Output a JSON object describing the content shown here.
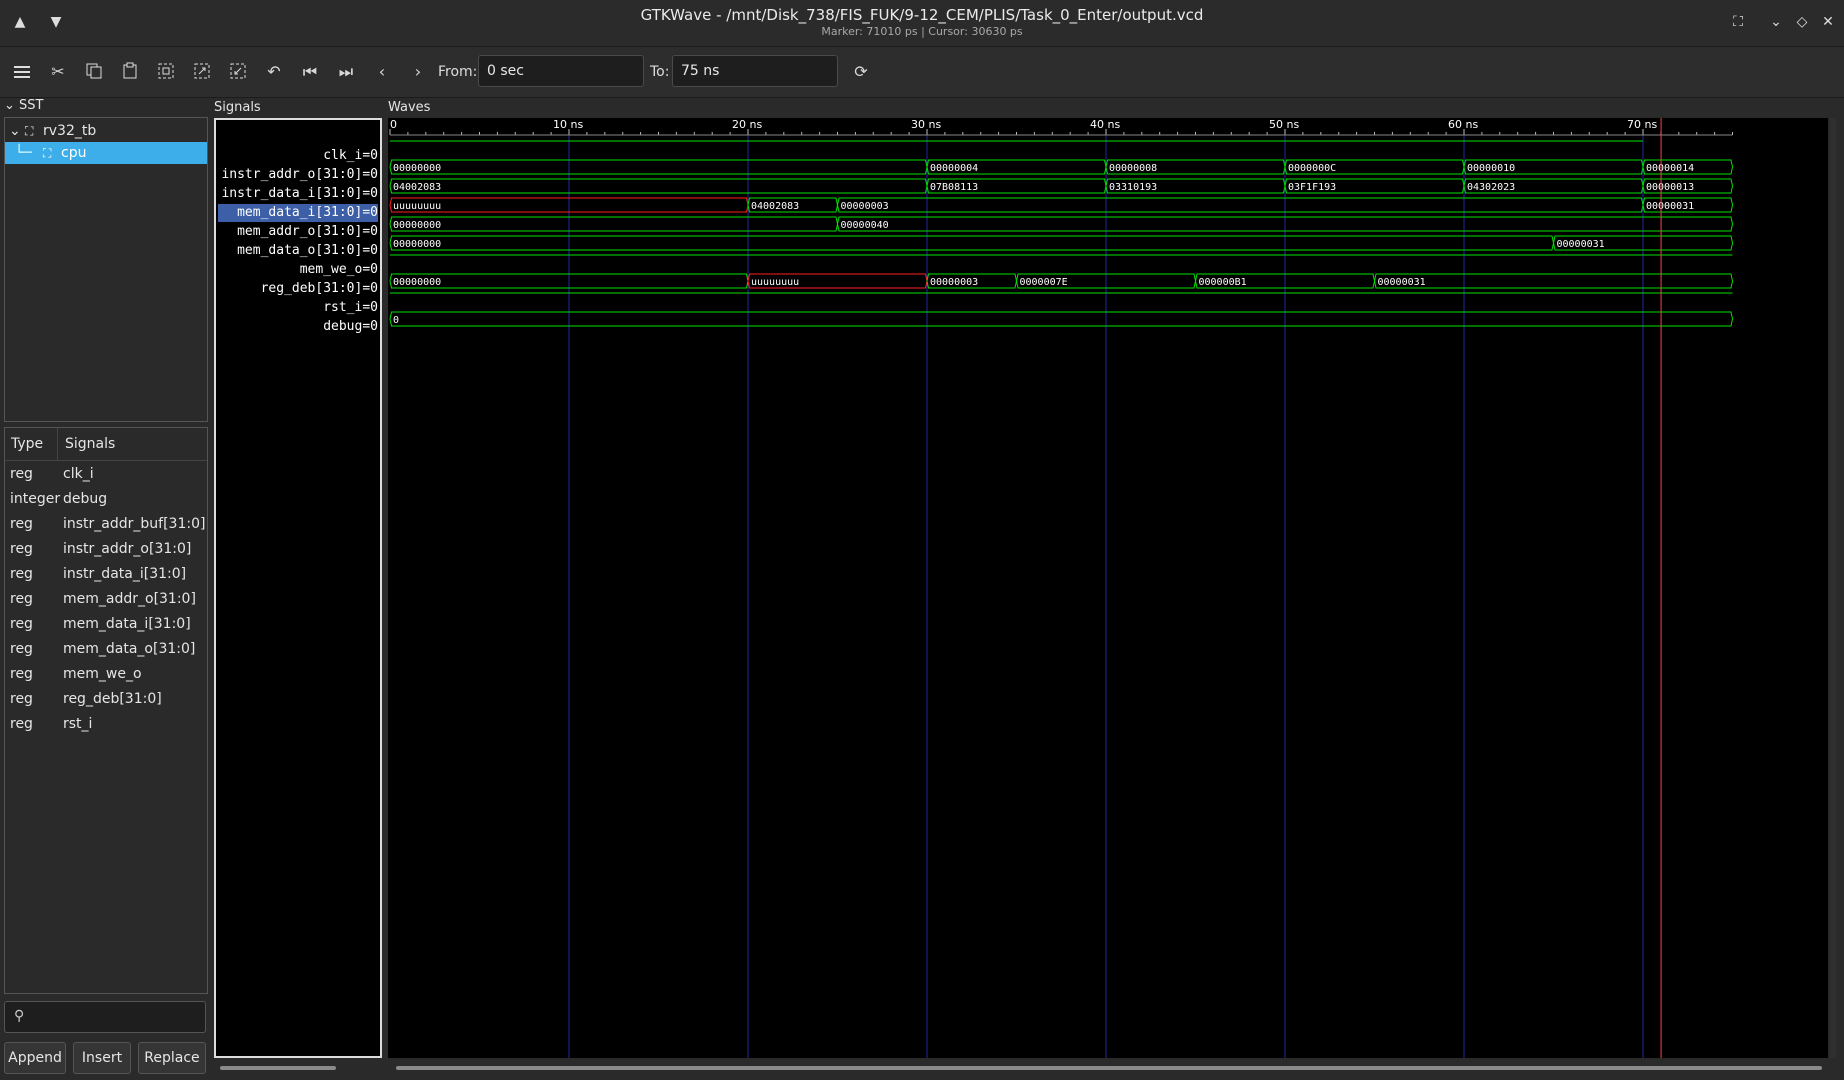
{
  "window": {
    "title": "GTKWave - /mnt/Disk_738/FIS_FUK/9-12_CEM/PLIS/Task_0_Enter/output.vcd",
    "subtitle": "Marker: 71010 ps  |  Cursor: 30630 ps"
  },
  "toolbar": {
    "from_label": "From:",
    "from_value": "0 sec",
    "to_label": "To:",
    "to_value": "75 ns"
  },
  "sst": {
    "title": "SST",
    "tree": [
      {
        "label": "rv32_tb"
      },
      {
        "label": "cpu",
        "selected": true
      }
    ],
    "columns": {
      "type": "Type",
      "signals": "Signals"
    },
    "signals": [
      {
        "type": "reg",
        "name": "clk_i"
      },
      {
        "type": "integer",
        "name": "debug"
      },
      {
        "type": "reg",
        "name": "instr_addr_buf[31:0]"
      },
      {
        "type": "reg",
        "name": "instr_addr_o[31:0]"
      },
      {
        "type": "reg",
        "name": "instr_data_i[31:0]"
      },
      {
        "type": "reg",
        "name": "mem_addr_o[31:0]"
      },
      {
        "type": "reg",
        "name": "mem_data_i[31:0]"
      },
      {
        "type": "reg",
        "name": "mem_data_o[31:0]"
      },
      {
        "type": "reg",
        "name": "mem_we_o"
      },
      {
        "type": "reg",
        "name": "reg_deb[31:0]"
      },
      {
        "type": "reg",
        "name": "rst_i"
      }
    ],
    "buttons": {
      "append": "Append",
      "insert": "Insert",
      "replace": "Replace"
    }
  },
  "signals_panel": {
    "title": "Signals",
    "rows": [
      {
        "label": "clk_i=0"
      },
      {
        "label": "instr_addr_o[31:0]=0"
      },
      {
        "label": "instr_data_i[31:0]=0"
      },
      {
        "label": "mem_data_i[31:0]=0",
        "highlight": true
      },
      {
        "label": "mem_addr_o[31:0]=0"
      },
      {
        "label": "mem_data_o[31:0]=0"
      },
      {
        "label": "mem_we_o=0"
      },
      {
        "label": "reg_deb[31:0]=0"
      },
      {
        "label": "rst_i=0"
      },
      {
        "label": "debug=0"
      }
    ]
  },
  "waves": {
    "title": "Waves",
    "time_unit": "ns",
    "time_range": [
      0,
      75
    ],
    "ticks": [
      {
        "t": 0,
        "label": "0"
      },
      {
        "t": 10,
        "label": "10 ns"
      },
      {
        "t": 20,
        "label": "20 ns"
      },
      {
        "t": 30,
        "label": "30 ns"
      },
      {
        "t": 40,
        "label": "40 ns"
      },
      {
        "t": 50,
        "label": "50 ns"
      },
      {
        "t": 60,
        "label": "60 ns"
      },
      {
        "t": 70,
        "label": "70 ns"
      }
    ],
    "marker_ns": 71.01,
    "colors": {
      "wave": "#00e000",
      "undefined": "#ff2020",
      "grid": "#1f2aa0",
      "marker": "#ff4040",
      "text": "#ffffff"
    },
    "traces": [
      {
        "kind": "clock",
        "period": 10,
        "half": 5,
        "first_high": 5,
        "end": 75
      },
      {
        "kind": "bus",
        "segments": [
          {
            "t0": 0,
            "t1": 30,
            "label": "00000000"
          },
          {
            "t0": 30,
            "t1": 40,
            "label": "00000004"
          },
          {
            "t0": 40,
            "t1": 50,
            "label": "00000008"
          },
          {
            "t0": 50,
            "t1": 60,
            "label": "0000000C"
          },
          {
            "t0": 60,
            "t1": 70,
            "label": "00000010"
          },
          {
            "t0": 70,
            "t1": 75,
            "label": "00000014"
          }
        ]
      },
      {
        "kind": "bus",
        "segments": [
          {
            "t0": 0,
            "t1": 30,
            "label": "04002083"
          },
          {
            "t0": 30,
            "t1": 40,
            "label": "07B08113"
          },
          {
            "t0": 40,
            "t1": 50,
            "label": "03310193"
          },
          {
            "t0": 50,
            "t1": 60,
            "label": "03F1F193"
          },
          {
            "t0": 60,
            "t1": 70,
            "label": "04302023"
          },
          {
            "t0": 70,
            "t1": 75,
            "label": "00000013"
          }
        ]
      },
      {
        "kind": "bus",
        "segments": [
          {
            "t0": 0,
            "t1": 20,
            "label": "uuuuuuuu",
            "undef": true
          },
          {
            "t0": 20,
            "t1": 25,
            "label": "04002083"
          },
          {
            "t0": 25,
            "t1": 70,
            "label": "00000003"
          },
          {
            "t0": 70,
            "t1": 75,
            "label": "00000031"
          }
        ]
      },
      {
        "kind": "bus",
        "segments": [
          {
            "t0": 0,
            "t1": 25,
            "label": "00000000"
          },
          {
            "t0": 25,
            "t1": 75,
            "label": "00000040"
          }
        ]
      },
      {
        "kind": "bus",
        "segments": [
          {
            "t0": 0,
            "t1": 65,
            "label": "00000000"
          },
          {
            "t0": 65,
            "t1": 75,
            "label": "00000031"
          }
        ]
      },
      {
        "kind": "bit",
        "edges": [
          [
            0,
            0
          ],
          [
            65,
            1
          ],
          [
            70,
            0
          ]
        ],
        "end": 75
      },
      {
        "kind": "bus",
        "segments": [
          {
            "t0": 0,
            "t1": 20,
            "label": "00000000"
          },
          {
            "t0": 20,
            "t1": 30,
            "label": "uuuuuuuu",
            "undef": true
          },
          {
            "t0": 30,
            "t1": 35,
            "label": "00000003"
          },
          {
            "t0": 35,
            "t1": 45,
            "label": "0000007E"
          },
          {
            "t0": 45,
            "t1": 55,
            "label": "000000B1"
          },
          {
            "t0": 55,
            "t1": 75,
            "label": "00000031"
          }
        ]
      },
      {
        "kind": "bit",
        "edges": [
          [
            0,
            1
          ],
          [
            20,
            0
          ]
        ],
        "end": 75
      },
      {
        "kind": "bus",
        "segments": [
          {
            "t0": 0,
            "t1": 75,
            "label": "0"
          }
        ]
      }
    ]
  }
}
